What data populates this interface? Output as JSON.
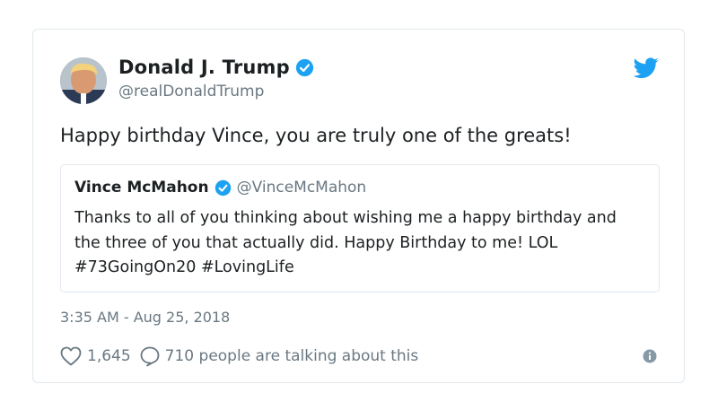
{
  "author": {
    "name": "Donald J. Trump",
    "handle": "@realDonaldTrump"
  },
  "tweet": {
    "text": "Happy birthday Vince, you are truly one of the greats!",
    "timestamp": "3:35 AM - Aug 25, 2018"
  },
  "quoted_tweet": {
    "name": "Vince McMahon",
    "handle": "@VinceMcMahon",
    "text": "Thanks to all of you thinking about wishing me a happy birthday and the three of you that actually did. Happy Birthday to me! LOL #73GoingOn20 #LovingLife"
  },
  "engagement": {
    "likes": "1,645",
    "talking": "710 people are talking about this"
  },
  "colors": {
    "twitter_blue": "#1da1f2",
    "secondary_text": "#697882",
    "border": "#e1e8ed"
  },
  "icons": {
    "verified": "verified-badge-icon",
    "brand": "twitter-bird-icon",
    "like": "heart-icon",
    "reply": "speech-bubble-icon",
    "info": "info-icon"
  }
}
